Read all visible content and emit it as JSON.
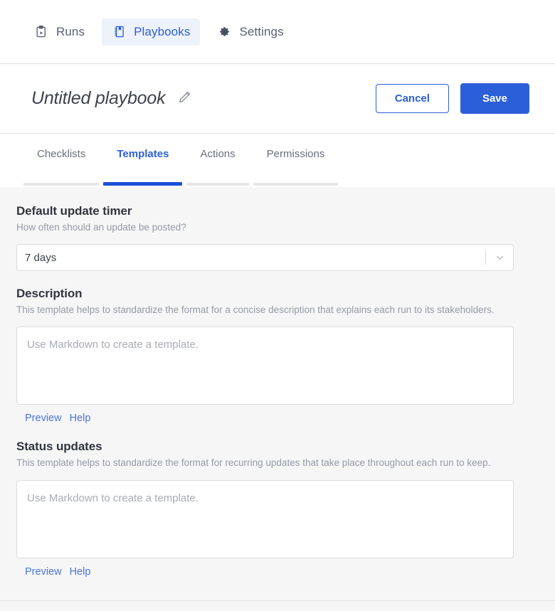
{
  "topnav": {
    "items": [
      {
        "label": "Runs",
        "icon": "clipboard-play-icon",
        "active": false
      },
      {
        "label": "Playbooks",
        "icon": "notebook-icon",
        "active": true
      },
      {
        "label": "Settings",
        "icon": "gear-icon",
        "active": false
      }
    ]
  },
  "header": {
    "title": "Untitled playbook",
    "edit_icon": "pencil-icon",
    "cancel_label": "Cancel",
    "save_label": "Save"
  },
  "tabs": [
    {
      "label": "Checklists",
      "active": false
    },
    {
      "label": "Templates",
      "active": true
    },
    {
      "label": "Actions",
      "active": false
    },
    {
      "label": "Permissions",
      "active": false
    }
  ],
  "sections": {
    "update_timer": {
      "title": "Default update timer",
      "subtitle": "How often should an update be posted?",
      "selected_value": "7 days",
      "chevron_icon": "chevron-down-icon"
    },
    "description": {
      "title": "Description",
      "subtitle": "This template helps to standardize the format for a concise description that explains each run to its stakeholders.",
      "value": "",
      "placeholder": "Use Markdown to create a template.",
      "preview_label": "Preview",
      "help_label": "Help"
    },
    "status_updates": {
      "title": "Status updates",
      "subtitle": "This template helps to standardize the format for recurring updates that take place throughout each run to keep.",
      "value": "",
      "placeholder": "Use Markdown to create a template.",
      "preview_label": "Preview",
      "help_label": "Help"
    }
  },
  "colors": {
    "accent_blue": "#2b5fd9",
    "active_tab_underline": "#1c4fd8",
    "link_blue": "#4a74df",
    "active_pill_bg": "#eef2fb",
    "page_bg": "#f6f6f7"
  }
}
